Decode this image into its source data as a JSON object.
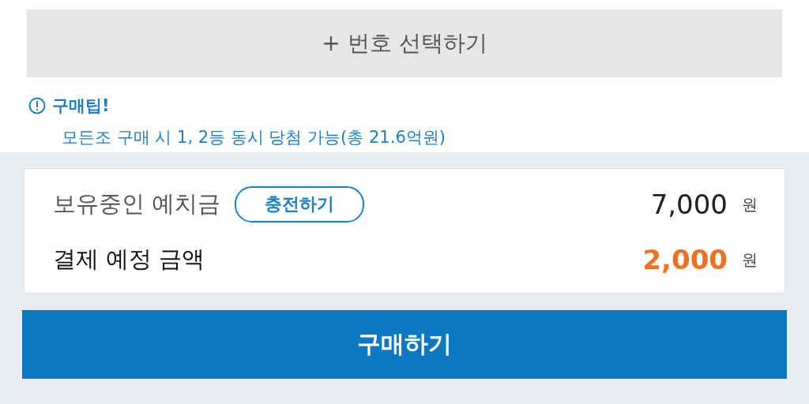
{
  "select_button": {
    "label": "+ 번호 선택하기"
  },
  "tip": {
    "title": "구매팁!",
    "text": "모든조 구매 시 1, 2등 동시 당첨 가능(총 21.6억원)"
  },
  "summary": {
    "rows": [
      {
        "kind": "balance",
        "label": "보유중인 예치금",
        "action": "충전하기",
        "amount": "7,000",
        "unit": "원"
      },
      {
        "kind": "payment",
        "label": "결제 예정 금액",
        "amount": "2,000",
        "unit": "원"
      }
    ]
  },
  "purchase_button": {
    "label": "구매하기"
  }
}
